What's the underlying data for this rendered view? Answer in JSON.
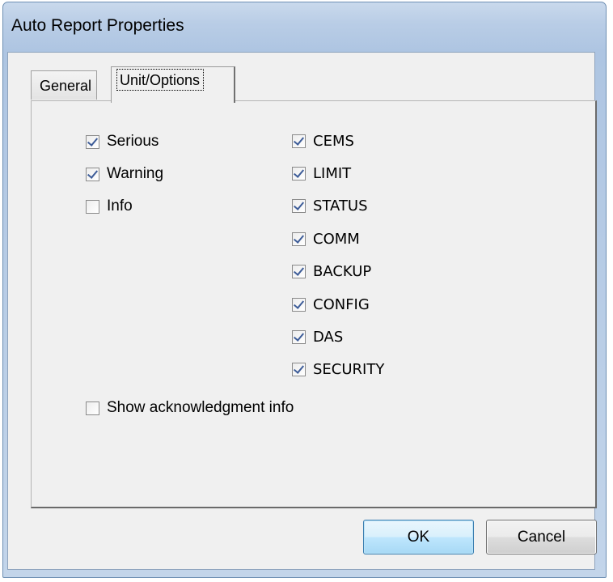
{
  "window": {
    "title": "Auto Report Properties"
  },
  "tabs": [
    {
      "label": "General",
      "selected": false
    },
    {
      "label": "Unit/Options",
      "selected": true
    }
  ],
  "severity_options": [
    {
      "label": "Serious",
      "checked": true
    },
    {
      "label": "Warning",
      "checked": true
    },
    {
      "label": "Info",
      "checked": false
    }
  ],
  "category_options": [
    {
      "label": "CEMS",
      "checked": true
    },
    {
      "label": "LIMIT",
      "checked": true
    },
    {
      "label": "STATUS",
      "checked": true
    },
    {
      "label": "COMM",
      "checked": true
    },
    {
      "label": "BACKUP",
      "checked": true
    },
    {
      "label": "CONFIG",
      "checked": true
    },
    {
      "label": "DAS",
      "checked": true
    },
    {
      "label": "SECURITY",
      "checked": true
    }
  ],
  "show_ack": {
    "label": "Show acknowledgment info",
    "checked": false
  },
  "buttons": {
    "ok": "OK",
    "cancel": "Cancel"
  }
}
